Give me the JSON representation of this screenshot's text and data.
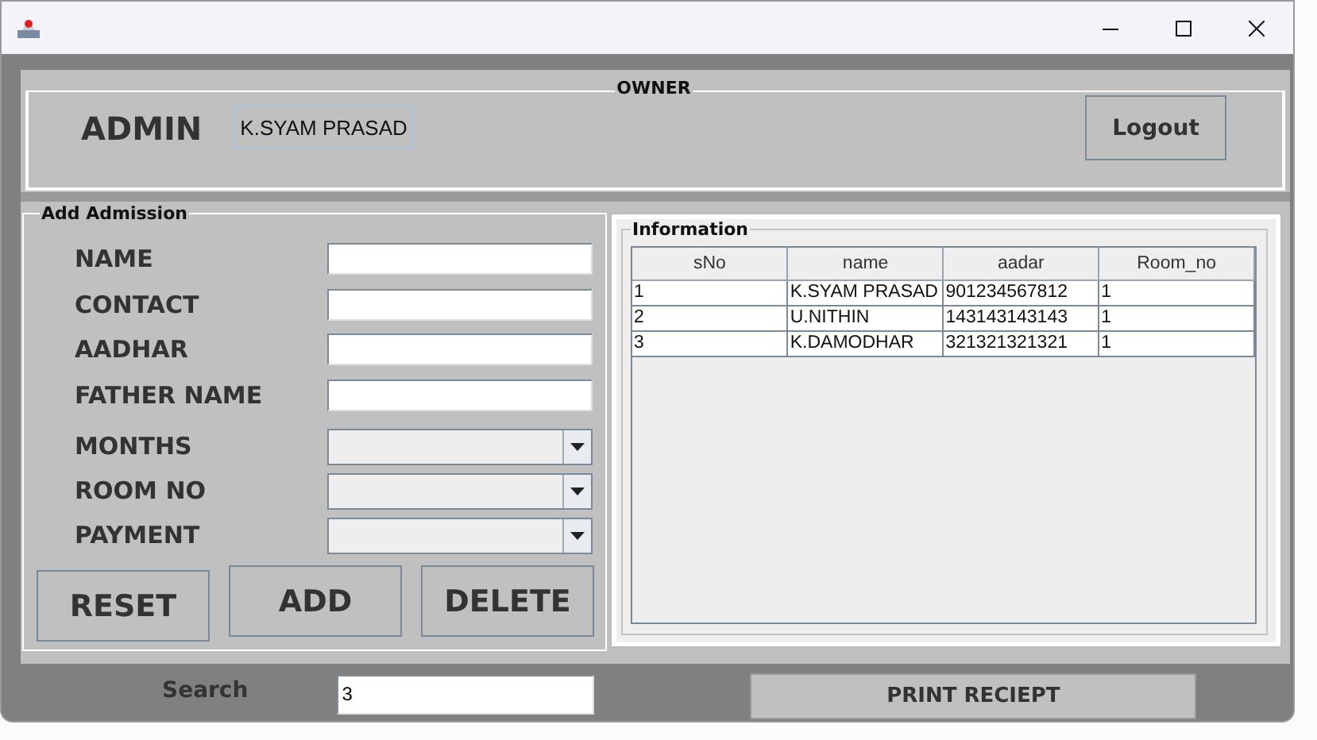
{
  "owner": {
    "title": "OWNER",
    "role": "ADMIN",
    "name": "K.SYAM PRASAD",
    "logout": "Logout"
  },
  "admission": {
    "title": "Add Admission",
    "fields": [
      {
        "label": "NAME",
        "kind": "text"
      },
      {
        "label": "CONTACT",
        "kind": "text"
      },
      {
        "label": "AADHAR",
        "kind": "text"
      },
      {
        "label": "FATHER NAME",
        "kind": "text"
      },
      {
        "label": "MONTHS",
        "kind": "dropdown"
      },
      {
        "label": "ROOM NO",
        "kind": "dropdown"
      },
      {
        "label": "PAYMENT",
        "kind": "dropdown"
      }
    ],
    "buttons": [
      "RESET",
      "ADD",
      "DELETE"
    ]
  },
  "information": {
    "title": "Information",
    "table": {
      "columns": [
        "sNo",
        "name",
        "aadar",
        "Room_no"
      ],
      "rows": [
        [
          "1",
          "K.SYAM PRASAD",
          "901234567812",
          "1"
        ],
        [
          "2",
          "U.NITHIN",
          "143143143143",
          "1"
        ],
        [
          "3",
          "K.DAMODHAR",
          "321321321321",
          "1"
        ]
      ]
    }
  },
  "footer": {
    "search_label": "Search",
    "search_value": "3",
    "print_button": "PRINT RECIEPT"
  }
}
